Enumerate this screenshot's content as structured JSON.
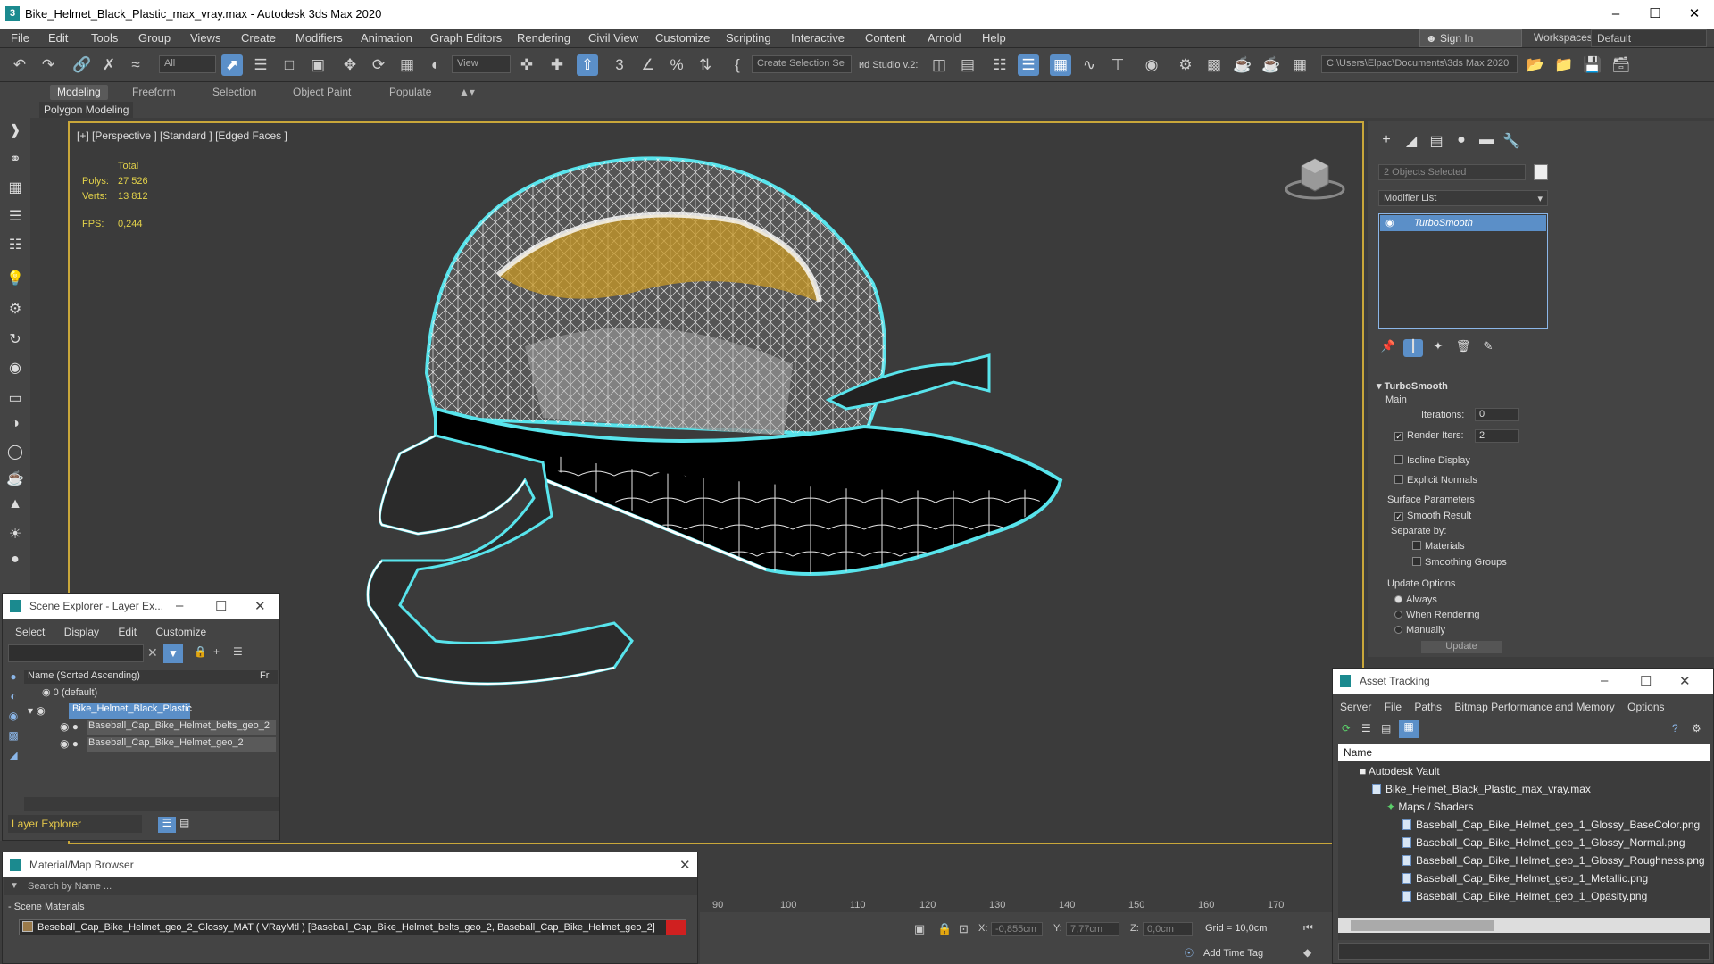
{
  "title": "Bike_Helmet_Black_Plastic_max_vray.max - Autodesk 3ds Max 2020",
  "menu": [
    "File",
    "Edit",
    "Tools",
    "Group",
    "Views",
    "Create",
    "Modifiers",
    "Animation",
    "Graph Editors",
    "Rendering",
    "Civil View",
    "Customize",
    "Scripting",
    "Interactive",
    "Content",
    "Arnold",
    "Help"
  ],
  "signin": "Sign In",
  "workspaces_label": "Workspaces:",
  "workspace": "Default",
  "toolbar": {
    "filter": "All",
    "view": "View",
    "selection_set": "Create Selection Se",
    "studio": "иd Studio v.2:",
    "path": "C:\\Users\\Elpac\\Documents\\3ds Max 2020"
  },
  "ribbon_tabs": [
    "Modeling",
    "Freeform",
    "Selection",
    "Object Paint",
    "Populate"
  ],
  "polygon_modeling": "Polygon Modeling",
  "viewport": {
    "label": "[+] [Perspective ] [Standard ] [Edged Faces ]",
    "total": "Total",
    "polys_label": "Polys:",
    "polys": "27 526",
    "verts_label": "Verts:",
    "verts": "13 812",
    "fps_label": "FPS:",
    "fps": "0,244"
  },
  "command_panel": {
    "objects_selected": "2 Objects Selected",
    "modifier_list": "Modifier List",
    "modifier": "TurboSmooth",
    "rollout_title": "TurboSmooth",
    "main": "Main",
    "iterations_label": "Iterations:",
    "iterations": "0",
    "render_iters_label": "Render Iters:",
    "render_iters": "2",
    "isoline": "Isoline Display",
    "explicit_normals": "Explicit Normals",
    "surface_params": "Surface Parameters",
    "smooth_result": "Smooth Result",
    "separate_by": "Separate by:",
    "materials": "Materials",
    "smoothing_groups": "Smoothing Groups",
    "update_options": "Update Options",
    "always": "Always",
    "when_rendering": "When Rendering",
    "manually": "Manually",
    "update_btn": "Update"
  },
  "scene_explorer": {
    "title": "Scene Explorer - Layer Ex...",
    "menu": [
      "Select",
      "Display",
      "Edit",
      "Customize"
    ],
    "col_name": "Name (Sorted Ascending)",
    "col_fr": "Fr",
    "rows": [
      "0 (default)",
      "Bike_Helmet_Black_Plastic",
      "Baseball_Cap_Bike_Helmet_belts_geo_2",
      "Baseball_Cap_Bike_Helmet_geo_2"
    ],
    "footer": "Layer Explorer"
  },
  "material_browser": {
    "title": "Material/Map Browser",
    "search": "Search by Name ...",
    "section": "Scene Materials",
    "item": "Beseball_Cap_Bike_Helmet_geo_2_Glossy_MAT ( VRayMtl ) [Baseball_Cap_Bike_Helmet_belts_geo_2, Baseball_Cap_Bike_Helmet_geo_2]"
  },
  "timeline_ticks": [
    "90",
    "100",
    "110",
    "120",
    "130",
    "140",
    "150",
    "160",
    "170"
  ],
  "status": {
    "x_label": "X:",
    "x": "-0,855cm",
    "y_label": "Y:",
    "y": "7,77cm",
    "z_label": "Z:",
    "z": "0,0cm",
    "grid": "Grid = 10,0cm",
    "add_time_tag": "Add Time Tag"
  },
  "asset_tracking": {
    "title": "Asset Tracking",
    "menu": [
      "Server",
      "File",
      "Paths",
      "Bitmap Performance and Memory",
      "Options"
    ],
    "col_name": "Name",
    "vault": "Autodesk Vault",
    "file": "Bike_Helmet_Black_Plastic_max_vray.max",
    "maps": "Maps / Shaders",
    "bitmaps": [
      "Baseball_Cap_Bike_Helmet_geo_1_Glossy_BaseColor.png",
      "Baseball_Cap_Bike_Helmet_geo_1_Glossy_Normal.png",
      "Baseball_Cap_Bike_Helmet_geo_1_Glossy_Roughness.png",
      "Baseball_Cap_Bike_Helmet_geo_1_Metallic.png",
      "Baseball_Cap_Bike_Helmet_geo_1_Opasity.png"
    ]
  }
}
